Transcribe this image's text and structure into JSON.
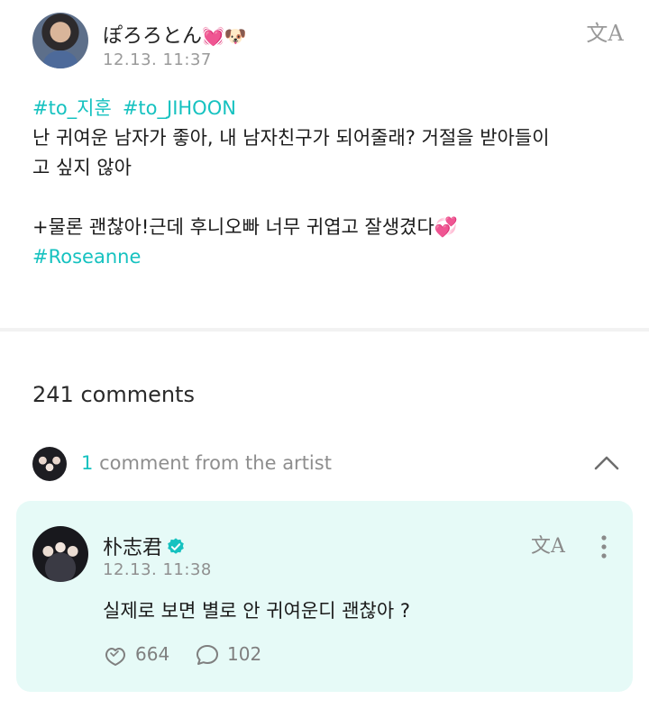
{
  "post": {
    "author_name": "ぽろろとん",
    "author_emoji": "💓🐶",
    "timestamp": "12.13. 11:37",
    "translate_icon": "文A",
    "hashtags_line": [
      "#to_지훈",
      "#to_JIHOON"
    ],
    "body_line1": "난 귀여운 남자가 좋아, 내 남자친구가 되어줄래? 거절을 받아들이",
    "body_line2": "고 싶지 않아",
    "body_line3": "+물론 괜찮아!근데 후니오빠 너무 귀엽고 잘생겼다💞",
    "hashtag_last": "#Roseanne"
  },
  "comments": {
    "count_label": "241 comments",
    "artist_count": "1",
    "artist_label": "comment from the artist"
  },
  "artist_comment": {
    "name": "朴志君",
    "timestamp": "12.13. 11:38",
    "translate_icon": "文A",
    "text": "실제로 보면 별로 안 귀여운디 괜찮아 ?",
    "likes": "664",
    "replies": "102"
  },
  "colors": {
    "accent": "#16c2c0",
    "card_bg": "#e6faf7",
    "muted": "#8f8f8f"
  },
  "icons": [
    "translate-icon",
    "chevron-up-icon",
    "verified-badge-icon",
    "more-vertical-icon",
    "like-icon",
    "reply-icon"
  ]
}
